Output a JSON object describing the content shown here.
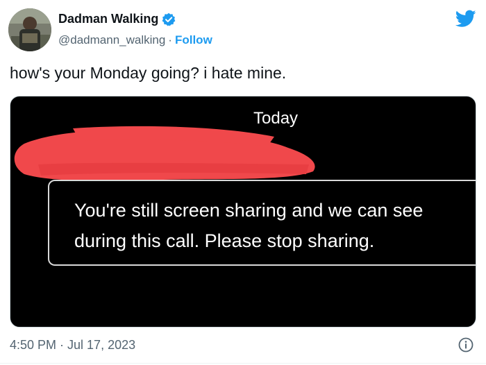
{
  "author": {
    "display_name": "Dadman Walking",
    "handle": "@dadmann_walking",
    "separator": "·",
    "follow_label": "Follow",
    "verified": true
  },
  "icons": {
    "verified": "verified-badge-icon",
    "brand": "twitter-bird-icon",
    "info": "info-icon"
  },
  "tweet": {
    "text": "how's your Monday going? i hate mine.",
    "media": {
      "header": "Today",
      "notice_line_1": "You're still screen sharing and we can see",
      "notice_line_2": "during this call. Please stop sharing."
    },
    "timestamp": "4:50 PM · Jul 17, 2023"
  },
  "colors": {
    "accent": "#1d9bf0",
    "text": "#0f1419",
    "secondary": "#536471",
    "media_bg": "#000000",
    "redaction": "#f0484b"
  }
}
